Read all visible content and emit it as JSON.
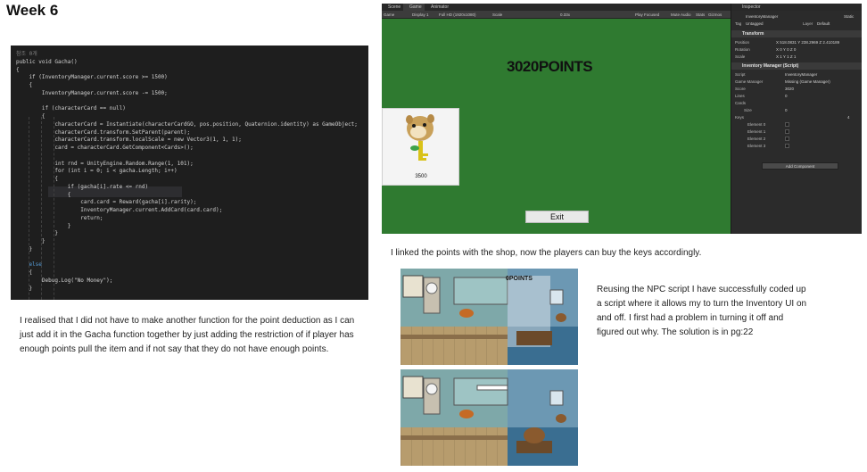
{
  "page": {
    "title": "Week 6"
  },
  "code": {
    "lines": [
      {
        "t": "참조 0개",
        "c": "#808080"
      },
      {
        "t": "public void Gacha()",
        "c": "#d4d4d4"
      },
      {
        "t": "{",
        "c": "#d4d4d4"
      },
      {
        "t": "    if (InventoryManager.current.score >= 1500)",
        "c": "#d4d4d4"
      },
      {
        "t": "    {",
        "c": "#d4d4d4"
      },
      {
        "t": "        InventoryManager.current.score -= 1500;",
        "c": "#d4d4d4"
      },
      {
        "t": "",
        "c": "#d4d4d4"
      },
      {
        "t": "        if (characterCard == null)",
        "c": "#d4d4d4"
      },
      {
        "t": "        {",
        "c": "#d4d4d4"
      },
      {
        "t": "            characterCard = Instantiate(characterCardGO, pos.position, Quaternion.identity) as GameObject;",
        "c": "#d4d4d4"
      },
      {
        "t": "            characterCard.transform.SetParent(parent);",
        "c": "#d4d4d4"
      },
      {
        "t": "            characterCard.transform.localScale = new Vector3(1, 1, 1);",
        "c": "#d4d4d4"
      },
      {
        "t": "            card = characterCard.GetComponent<Cards>();",
        "c": "#d4d4d4"
      },
      {
        "t": "",
        "c": "#d4d4d4"
      },
      {
        "t": "            int rnd = UnityEngine.Random.Range(1, 101);",
        "c": "#d4d4d4"
      },
      {
        "t": "            for (int i = 0; i < gacha.Length; i++)",
        "c": "#d4d4d4"
      },
      {
        "t": "            {",
        "c": "#d4d4d4"
      },
      {
        "t": "                if (gacha[i].rate <= rnd)",
        "c": "#d4d4d4"
      },
      {
        "t": "                {",
        "c": "#d4d4d4"
      },
      {
        "t": "                    card.card = Reward(gacha[i].rarity);",
        "c": "#d4d4d4"
      },
      {
        "t": "                    InventoryManager.current.AddCard(card.card);",
        "c": "#d4d4d4"
      },
      {
        "t": "                    return;",
        "c": "#d4d4d4"
      },
      {
        "t": "                }",
        "c": "#d4d4d4"
      },
      {
        "t": "            }",
        "c": "#d4d4d4"
      },
      {
        "t": "        }",
        "c": "#d4d4d4"
      },
      {
        "t": "    }",
        "c": "#d4d4d4"
      },
      {
        "t": "",
        "c": "#d4d4d4"
      },
      {
        "t": "    else",
        "c": "#569cd6"
      },
      {
        "t": "    {",
        "c": "#d4d4d4"
      },
      {
        "t": "        Debug.Log(\"No Money\");",
        "c": "#d4d4d4"
      },
      {
        "t": "    }",
        "c": "#d4d4d4"
      }
    ]
  },
  "paragraphs": {
    "gacha": "I realised that I did not have to make another function for the point deduction as I can just add it in the Gacha function together by just adding the restriction of if player has enough points pull the item and if not say that they do not have enough points.",
    "shop": "I linked the points with the shop, now the players can buy the keys accordingly.",
    "npc": "Reusing the NPC script I have successfully coded up a script where it allows my to turn the Inventory UI on and off. I first had a problem in turning it off and figured out why. The solution is in pg:22"
  },
  "unity": {
    "tabs": [
      "Scene",
      "Game",
      "Animator"
    ],
    "toolbar": {
      "display": "Game",
      "display_n": "Display 1",
      "resolution": "Full HD (1920x1080)",
      "scale_label": "Scale",
      "scale_value": "0.33x",
      "play_mode": "Play Focused",
      "mute": "Mute Audio",
      "stats": "Stats",
      "gizmos": "Gizmos"
    },
    "game": {
      "points": "3020POINTS",
      "card_value": "3500",
      "exit_label": "Exit"
    },
    "inspector": {
      "tab": "Inspector",
      "object_name": "InventoryManager",
      "static": "Static",
      "tag_label": "Tag",
      "tag_value": "Untagged",
      "layer_label": "Layer",
      "layer_value": "Default",
      "transform": "Transform",
      "position": "Position",
      "position_vals": "X 518.0831   Y 238.2969   Z 2.410189",
      "rotation": "Rotation",
      "rotation_vals": "X 0   Y 0   Z 0",
      "scale": "Scale",
      "scale_vals": "X 1   Y 1   Z 1",
      "script_component": "Inventory Manager (Script)",
      "script_label": "Script",
      "script_value": "InventoryManager",
      "game_manager_label": "Game Manager",
      "game_manager_value": "Missing (Game Manager)",
      "score_label": "Score",
      "score_value": "3020",
      "lines_label": "Lines",
      "lines_value": "0",
      "cards_label": "Cards",
      "size_label": "Size",
      "size_value": "0",
      "keys_label": "Keys",
      "keys_size": "4",
      "elements": [
        "Element 0",
        "Element 1",
        "Element 2",
        "Element 3"
      ],
      "add_component": "Add Component"
    }
  },
  "shots": {
    "top_points": "0POINTS"
  }
}
